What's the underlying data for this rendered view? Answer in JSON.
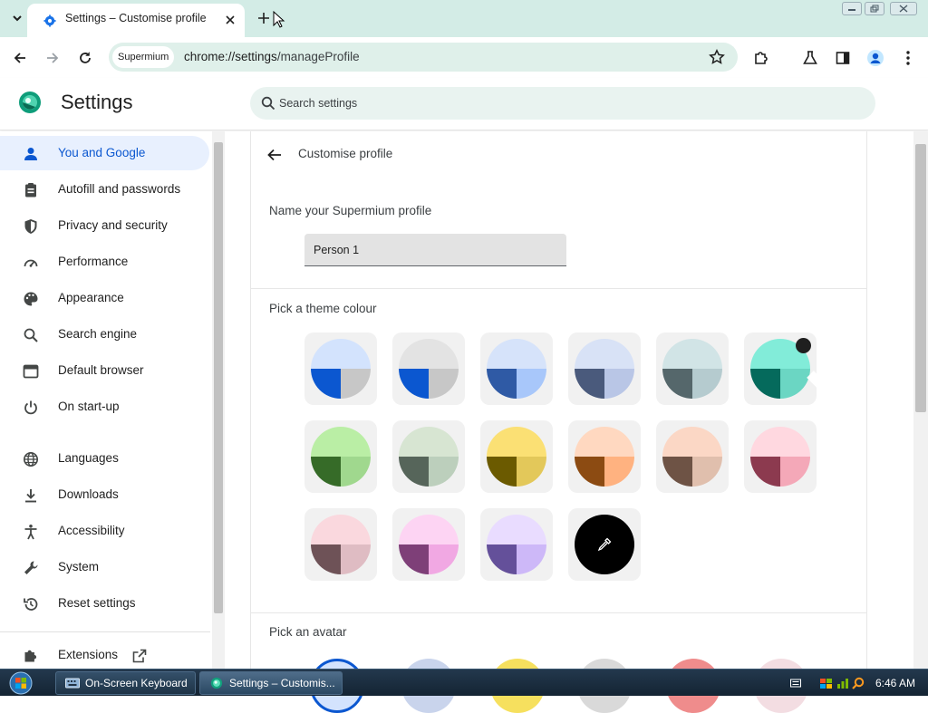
{
  "browser": {
    "tab": {
      "title": "Settings – Customise profile",
      "favicon": "gear-icon"
    },
    "omnibox": {
      "chip": "Supermium",
      "url_scheme": "chrome://",
      "url_host": "settings",
      "url_path": "/manageProfile"
    }
  },
  "settings": {
    "header": {
      "title": "Settings",
      "search_placeholder": "Search settings"
    },
    "sidebar": {
      "items": [
        {
          "label": "You and Google",
          "icon": "person-icon"
        },
        {
          "label": "Autofill and passwords",
          "icon": "clipboard-icon"
        },
        {
          "label": "Privacy and security",
          "icon": "shield-icon"
        },
        {
          "label": "Performance",
          "icon": "speedometer-icon"
        },
        {
          "label": "Appearance",
          "icon": "palette-icon"
        },
        {
          "label": "Search engine",
          "icon": "search-icon"
        },
        {
          "label": "Default browser",
          "icon": "browser-window-icon"
        },
        {
          "label": "On start-up",
          "icon": "power-icon"
        },
        {
          "label": "Languages",
          "icon": "globe-icon"
        },
        {
          "label": "Downloads",
          "icon": "download-icon"
        },
        {
          "label": "Accessibility",
          "icon": "accessibility-icon"
        },
        {
          "label": "System",
          "icon": "wrench-icon"
        },
        {
          "label": "Reset settings",
          "icon": "history-icon"
        },
        {
          "label": "Extensions",
          "icon": "puzzle-icon"
        }
      ],
      "active_index": 0
    },
    "page": {
      "title": "Customise profile",
      "name_section_label": "Name your Supermium profile",
      "name_value": "Person 1",
      "theme_section_label": "Pick a theme colour",
      "avatar_section_label": "Pick an avatar",
      "selected_theme_index": 5,
      "themes": [
        {
          "top": "#d3e3fd",
          "left": "#0b57d0",
          "right": "#c7c7c7"
        },
        {
          "top": "#e3e3e3",
          "left": "#0b57d0",
          "right": "#c7c7c7"
        },
        {
          "top": "#d6e3fa",
          "left": "#2f5aa5",
          "right": "#a8c7fa"
        },
        {
          "top": "#d8e2f6",
          "left": "#4a5a7c",
          "right": "#b9c6e6"
        },
        {
          "top": "#d1e4e6",
          "left": "#55676b",
          "right": "#b5cbcf"
        },
        {
          "top": "#82ecd9",
          "left": "#056a5c",
          "right": "#6bd6c3"
        },
        {
          "top": "#baeea5",
          "left": "#366b28",
          "right": "#a0d88e"
        },
        {
          "top": "#d7e5d2",
          "left": "#56655a",
          "right": "#bccfbc"
        },
        {
          "top": "#fbe074",
          "left": "#6b5a00",
          "right": "#e3c85a"
        },
        {
          "top": "#ffd8c0",
          "left": "#8c4b12",
          "right": "#ffb280"
        },
        {
          "top": "#fbd7c5",
          "left": "#6e5345",
          "right": "#e0bfad"
        },
        {
          "top": "#ffd8e0",
          "left": "#8c3a4f",
          "right": "#f4a8b8"
        },
        {
          "top": "#fad8de",
          "left": "#6e5257",
          "right": "#dfbcc3"
        },
        {
          "top": "#fdd4f3",
          "left": "#7e3f78",
          "right": "#f1a8e3"
        },
        {
          "top": "#e9dcff",
          "left": "#64509a",
          "right": "#cdb8f8"
        }
      ],
      "custom_colour_icon": "eyedropper-icon"
    }
  },
  "taskbar": {
    "buttons": [
      {
        "label": "On-Screen Keyboard",
        "icon": "keyboard-icon"
      },
      {
        "label": "Settings – Customis...",
        "icon": "supermium-icon"
      }
    ],
    "clock": "6:46 AM"
  }
}
